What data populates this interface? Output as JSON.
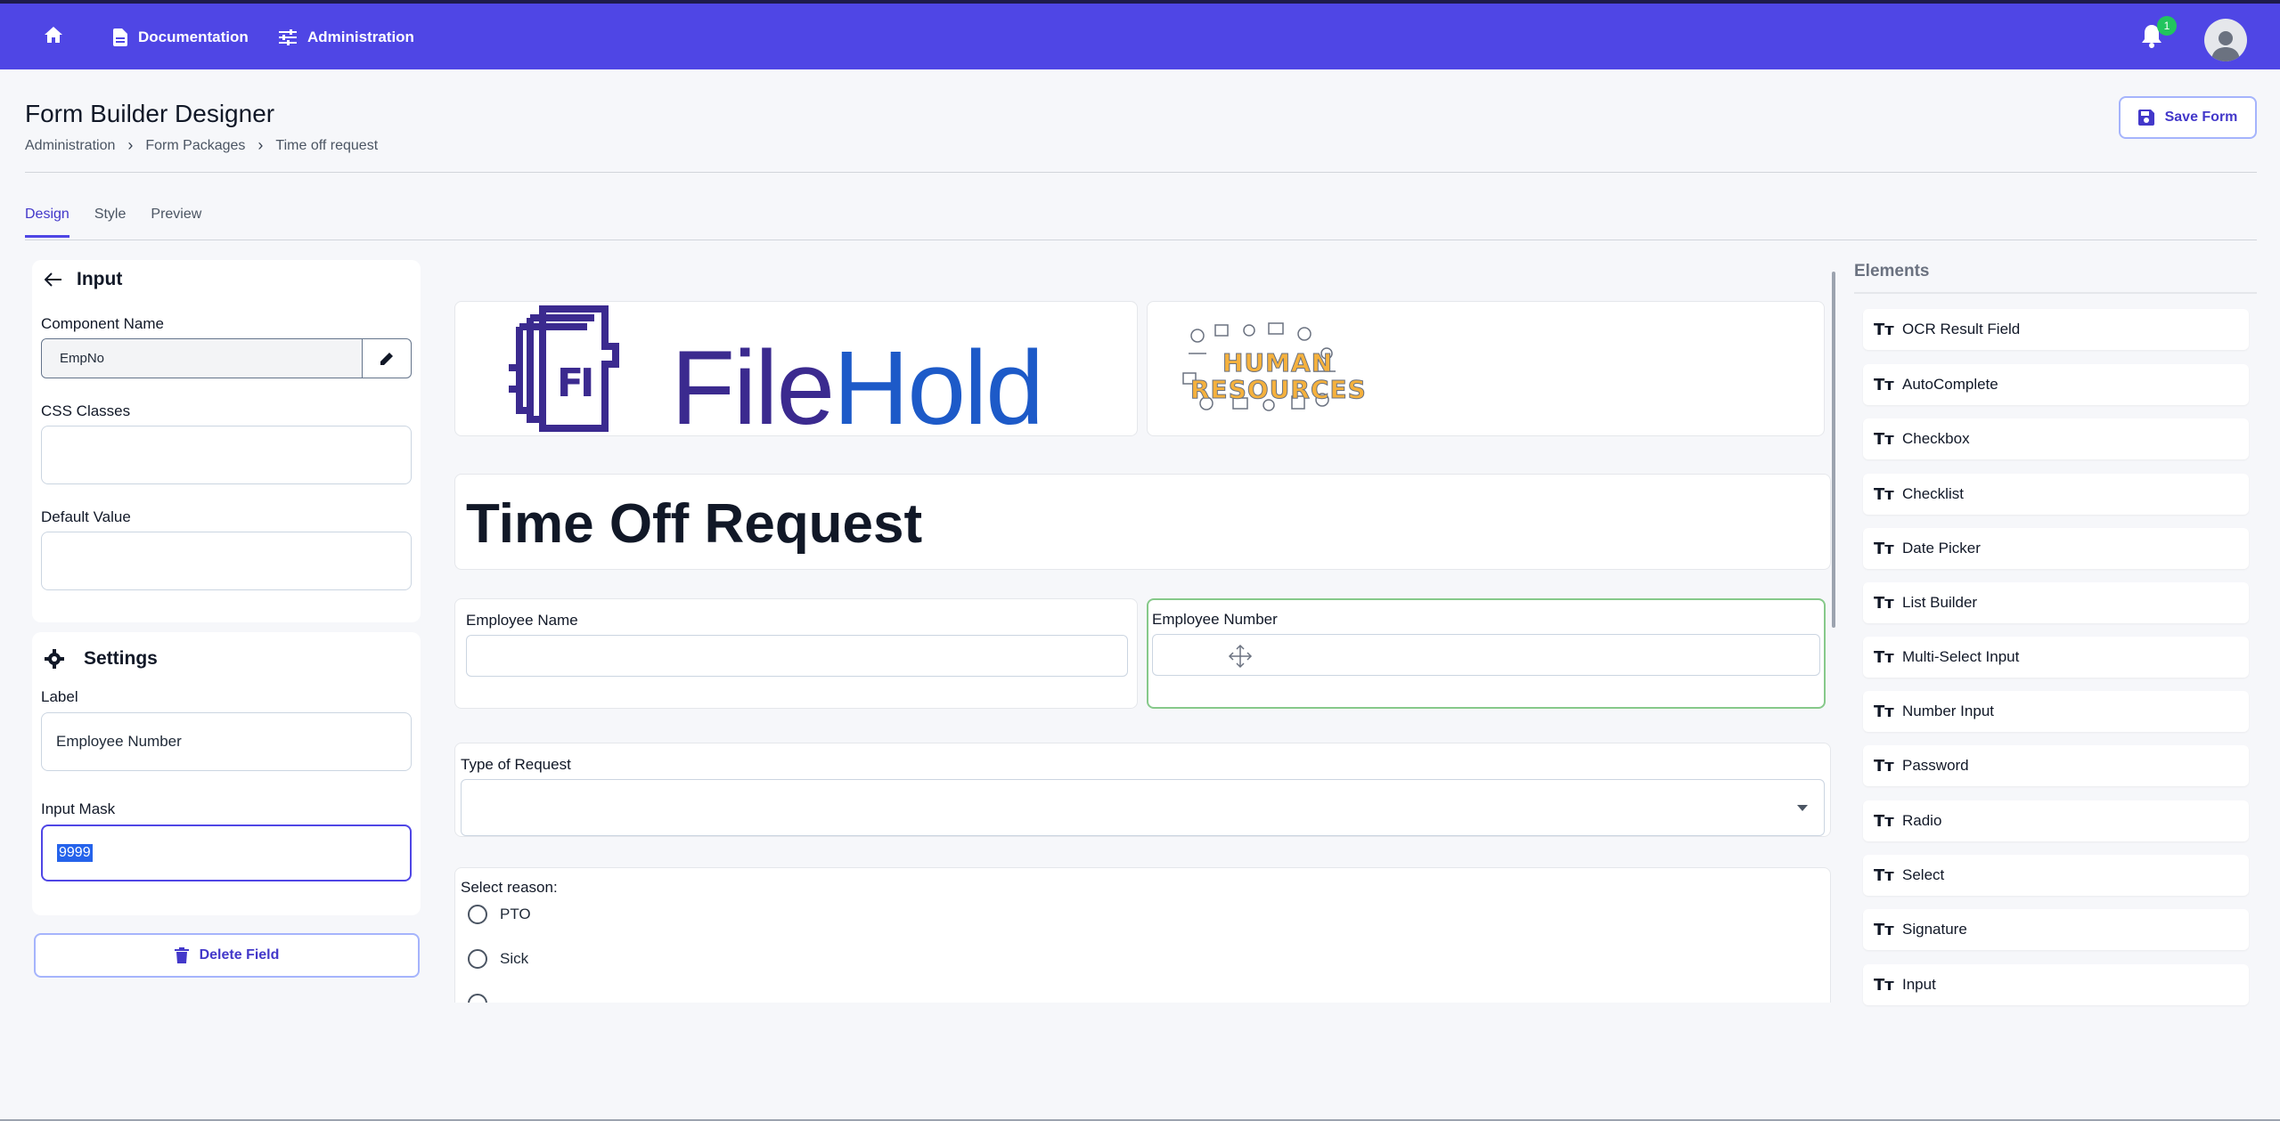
{
  "nav": {
    "documentation": "Documentation",
    "administration": "Administration",
    "notifications_count": "1"
  },
  "header": {
    "title": "Form Builder Designer",
    "breadcrumb": [
      "Administration",
      "Form Packages",
      "Time off request"
    ],
    "save_label": "Save Form"
  },
  "tabs": [
    "Design",
    "Style",
    "Preview"
  ],
  "left_panel": {
    "section_title": "Input",
    "component_name_label": "Component Name",
    "component_name_value": "EmpNo",
    "css_classes_label": "CSS Classes",
    "default_value_label": "Default Value",
    "settings_title": "Settings",
    "label_label": "Label",
    "label_value": "Employee Number",
    "input_mask_label": "Input Mask",
    "input_mask_value": "9999",
    "delete_label": "Delete Field"
  },
  "form": {
    "logo_file": "File",
    "logo_hold": "Hold",
    "hr_word1": "HUMAN",
    "hr_word2": "RESOURCES",
    "title": "Time Off Request",
    "employee_name_label": "Employee Name",
    "employee_number_label": "Employee Number",
    "type_of_request_label": "Type of Request",
    "select_reason_label": "Select reason:",
    "reasons": [
      "PTO",
      "Sick"
    ]
  },
  "elements": {
    "title": "Elements",
    "icon": "Tт",
    "items": [
      "OCR Result Field",
      "AutoComplete",
      "Checkbox",
      "Checklist",
      "Date Picker",
      "List Builder",
      "Multi-Select Input",
      "Number Input",
      "Password",
      "Radio",
      "Select",
      "Signature",
      "Input"
    ]
  },
  "colors": {
    "nav_bg": "#4f46e5",
    "accent": "#4338ca",
    "selected_border": "#86c98a"
  }
}
